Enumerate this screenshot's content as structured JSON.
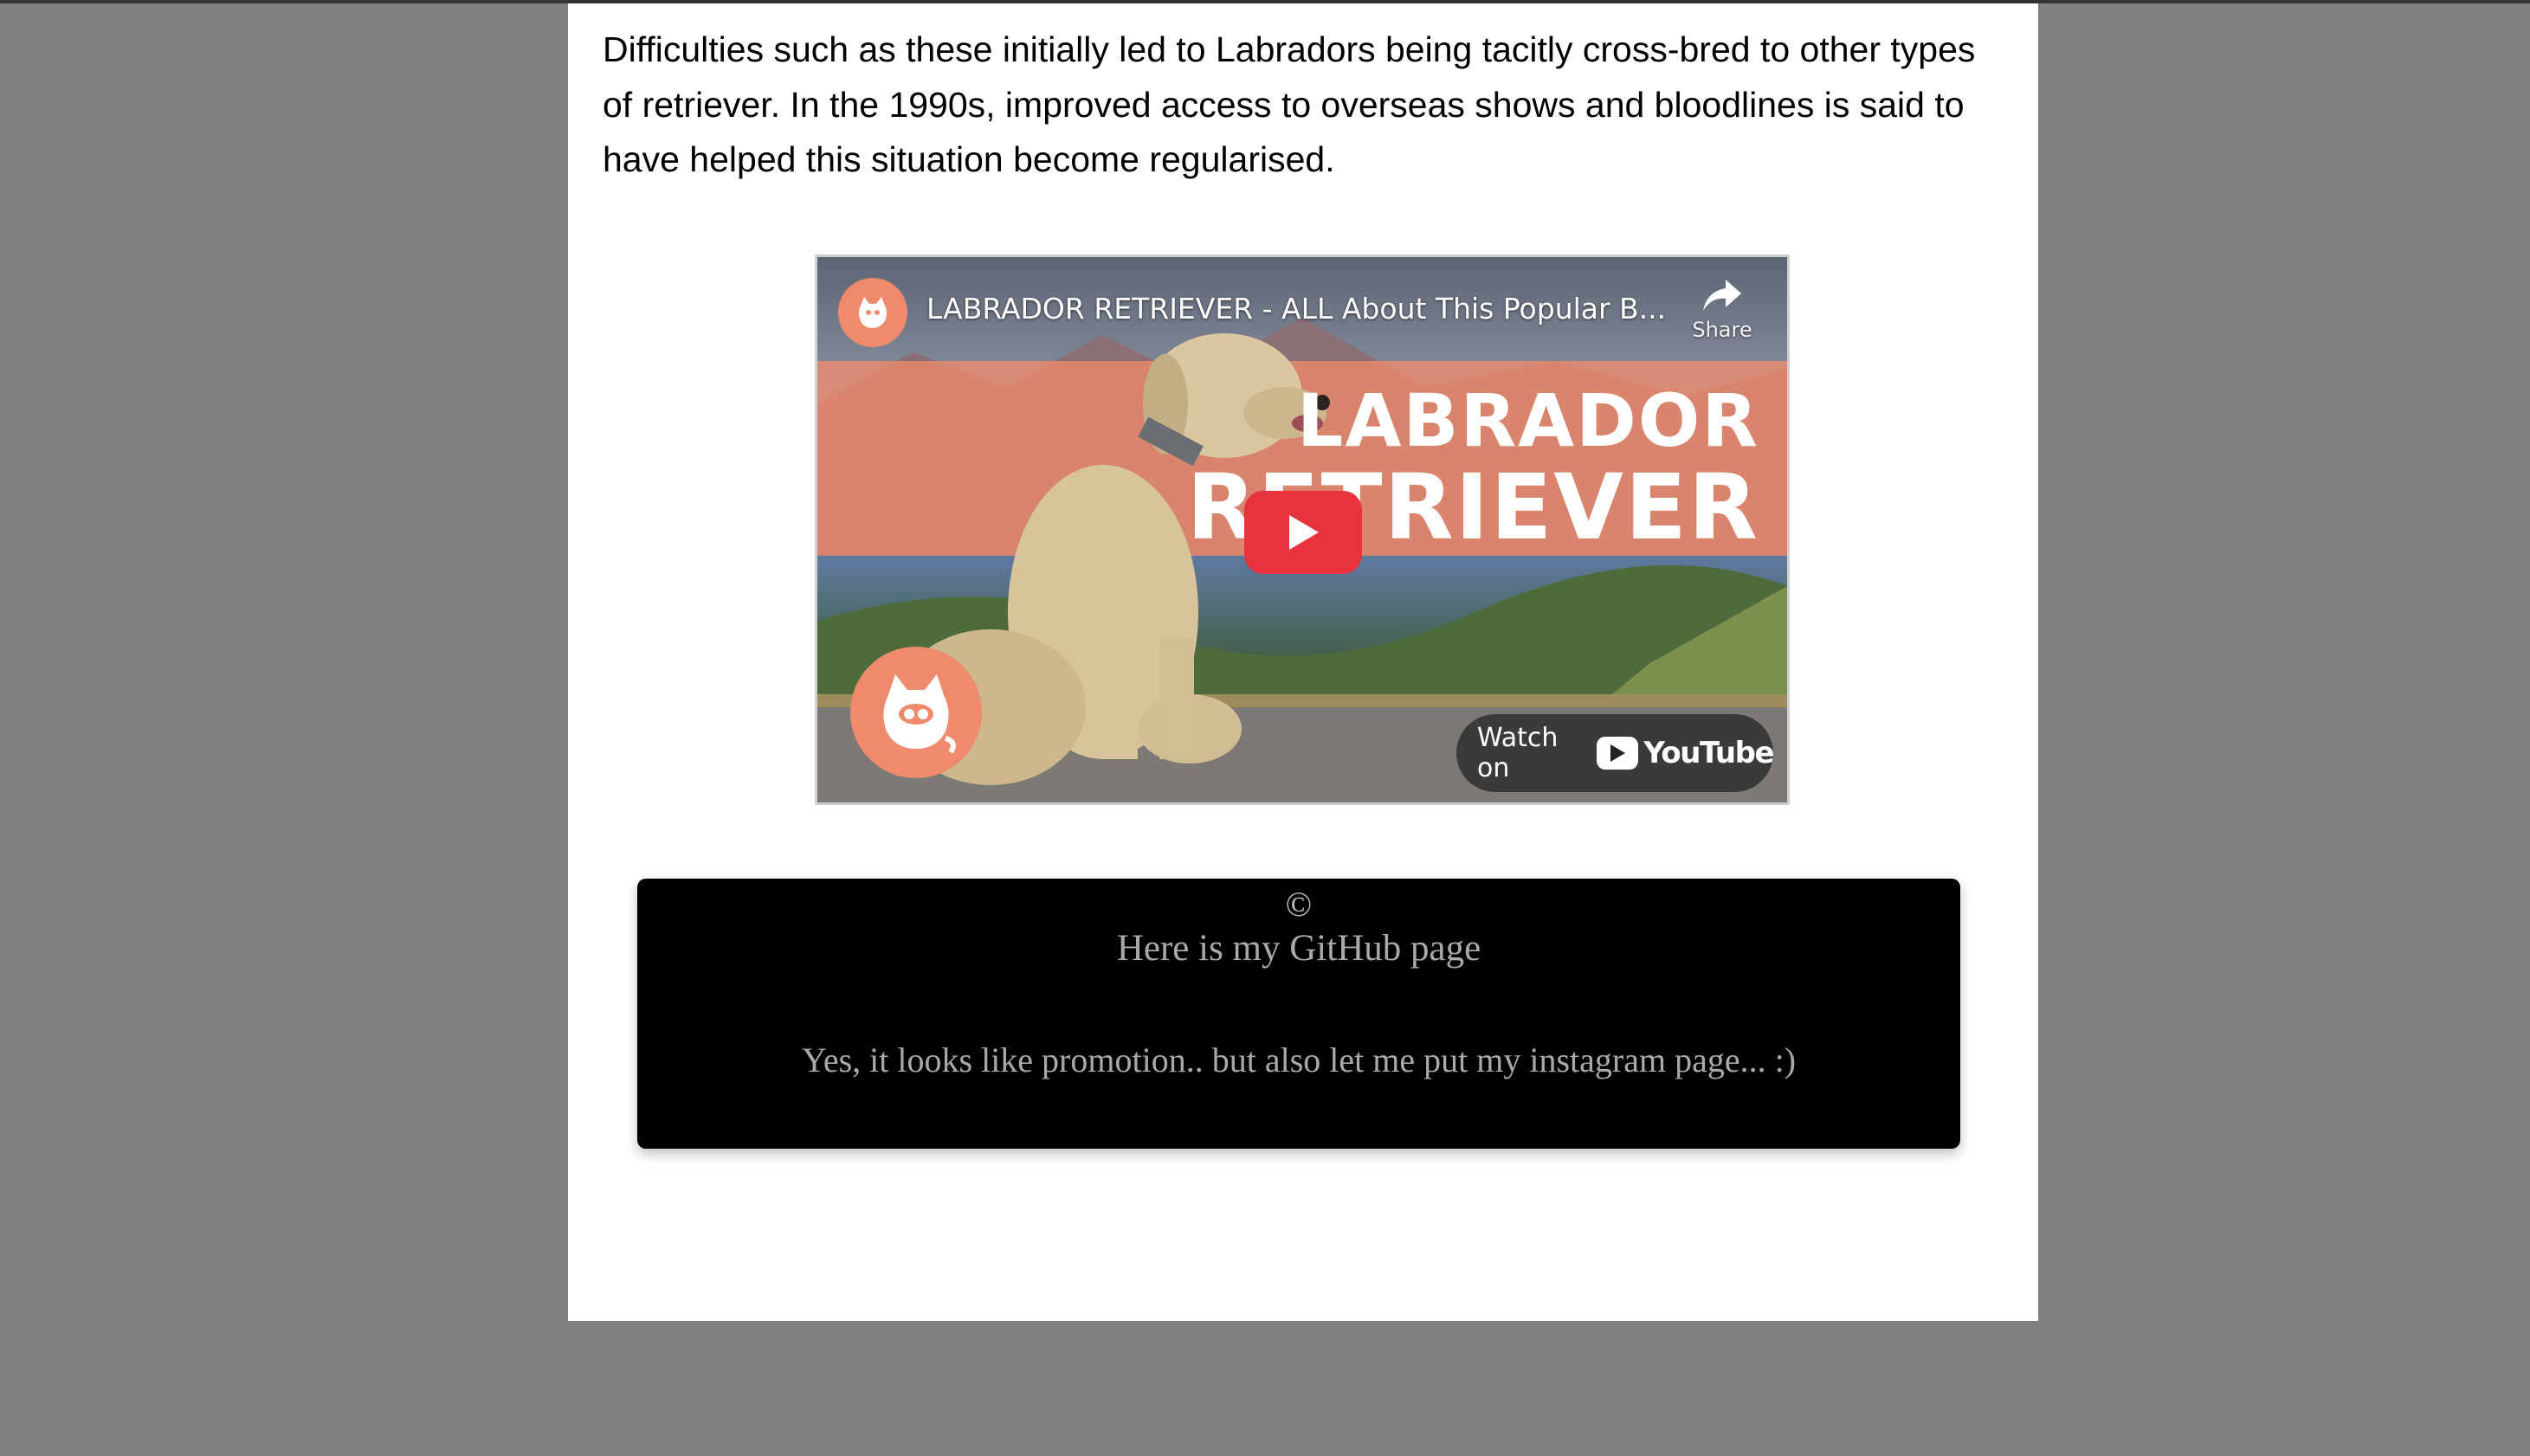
{
  "article": {
    "paragraph": "Difficulties such as these initially led to Labradors being tacitly cross-bred to other types of retriever. In the 1990s, improved access to overseas shows and bloodlines is said to have helped this situation become regularised."
  },
  "video": {
    "title": "LABRADOR RETRIEVER - ALL About This Popular B...",
    "share_label": "Share",
    "overlay_line1": "LABRADOR",
    "overlay_line2": "RETRIEVER",
    "watch_on_label": "Watch on",
    "youtube_wordmark": "YouTube",
    "channel_icon": "cat-logo-icon",
    "play_icon": "play-icon",
    "colors": {
      "brand_orange": "#ef8a6c",
      "play_red": "#e8323c"
    }
  },
  "footer": {
    "copyright": "©",
    "github_link": "Here is my GitHub page",
    "instagram_link": "Yes, it looks like promotion.. but also let me put my instagram page... :)"
  }
}
